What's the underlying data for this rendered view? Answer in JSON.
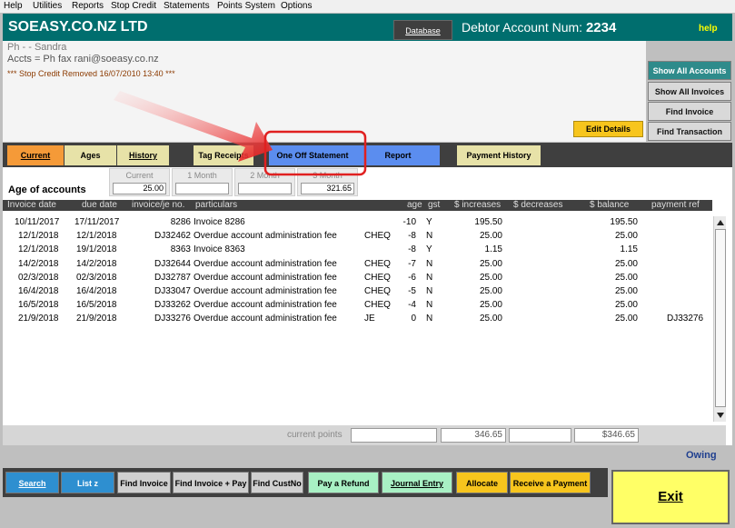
{
  "menu": [
    "Help",
    "Utilities",
    "Reports",
    "Stop Credit",
    "Statements",
    "Points System",
    "Options"
  ],
  "header": {
    "company": "SOEASY.CO.NZ LTD",
    "database_button": "Database",
    "debtor_label": "Debtor Account Num:",
    "debtor_number": "2234",
    "help": "help"
  },
  "contact": {
    "line1": "Ph  -  - Sandra",
    "line2": "Accts =  Ph  fax  rani@soeasy.co.nz",
    "notice": "*** Stop Credit Removed 16/07/2010 13:40 ***"
  },
  "right_buttons": {
    "show_all_accounts": "Show All Accounts",
    "show_all_invoices": "Show All Invoices",
    "find_invoice": "Find Invoice",
    "find_transaction": "Find Transaction",
    "edit_details": "Edit Details"
  },
  "tabs": {
    "current": "Current",
    "ages": "Ages",
    "history": "History",
    "tag_receipts": "Tag Receipts",
    "one_off_statement": "One Off Statement",
    "report": "Report",
    "payment_history": "Payment History"
  },
  "aging": {
    "title": "Age of accounts",
    "current_label": "Current",
    "current_value": "25.00",
    "month1_label": "1 Month",
    "month1_value": "",
    "month2_label": "2 Month",
    "month2_value": "",
    "month3_label": "3 Month",
    "month3_value": "321.65"
  },
  "table": {
    "headers": {
      "invoice_date": "Invoice date",
      "due_date": "due date",
      "invoice_no": "invoice/je no.",
      "particulars": "particulars",
      "age": "age",
      "gst": "gst",
      "increases": "$ increases",
      "decreases": "$ decreases",
      "balance": "$ balance",
      "payment_ref": "payment ref"
    },
    "rows": [
      {
        "inv_date": "10/11/2017",
        "due": "17/11/2017",
        "no": "8286",
        "part": "Invoice 8286",
        "type": "",
        "age": "-10",
        "gst": "Y",
        "inc": "195.50",
        "bal": "195.50",
        "ref": ""
      },
      {
        "inv_date": "12/1/2018",
        "due": "12/1/2018",
        "no": "DJ32462",
        "part": "Overdue account administration fee",
        "type": "CHEQ",
        "age": "-8",
        "gst": "N",
        "inc": "25.00",
        "bal": "25.00",
        "ref": ""
      },
      {
        "inv_date": "12/1/2018",
        "due": "19/1/2018",
        "no": "8363",
        "part": "Invoice 8363",
        "type": "",
        "age": "-8",
        "gst": "Y",
        "inc": "1.15",
        "bal": "1.15",
        "ref": ""
      },
      {
        "inv_date": "14/2/2018",
        "due": "14/2/2018",
        "no": "DJ32644",
        "part": "Overdue account administration fee",
        "type": "CHEQ",
        "age": "-7",
        "gst": "N",
        "inc": "25.00",
        "bal": "25.00",
        "ref": ""
      },
      {
        "inv_date": "02/3/2018",
        "due": "02/3/2018",
        "no": "DJ32787",
        "part": "Overdue account administration fee",
        "type": "CHEQ",
        "age": "-6",
        "gst": "N",
        "inc": "25.00",
        "bal": "25.00",
        "ref": ""
      },
      {
        "inv_date": "16/4/2018",
        "due": "16/4/2018",
        "no": "DJ33047",
        "part": "Overdue account administration fee",
        "type": "CHEQ",
        "age": "-5",
        "gst": "N",
        "inc": "25.00",
        "bal": "25.00",
        "ref": ""
      },
      {
        "inv_date": "16/5/2018",
        "due": "16/5/2018",
        "no": "DJ33262",
        "part": "Overdue account administration fee",
        "type": "CHEQ",
        "age": "-4",
        "gst": "N",
        "inc": "25.00",
        "bal": "25.00",
        "ref": ""
      },
      {
        "inv_date": "21/9/2018",
        "due": "21/9/2018",
        "no": "DJ33276",
        "part": "Overdue account administration fee",
        "type": "JE",
        "age": "0",
        "gst": "N",
        "inc": "25.00",
        "bal": "25.00",
        "ref": "DJ33276"
      }
    ]
  },
  "totals": {
    "current_points_label": "current points",
    "current_points": "",
    "increases": "346.65",
    "decreases": "",
    "balance": "$346.65"
  },
  "owing": "Owing",
  "bottom_buttons": {
    "search": "Search",
    "list_z": "List z",
    "find_invoice": "Find Invoice",
    "find_invoice_pay": "Find Invoice + Pay",
    "find_custno": "Find CustNo",
    "pay_refund": "Pay a Refund",
    "journal_entry": "Journal Entry",
    "allocate": "Allocate",
    "receive_payment": "Receive a Payment",
    "exit": "Exit"
  },
  "colors": {
    "teal": "#006e6e",
    "orange_tab": "#f59a38",
    "tan_tab": "#e7e2a8",
    "blue_tab": "#5b8def",
    "highlight": "#e02020"
  }
}
